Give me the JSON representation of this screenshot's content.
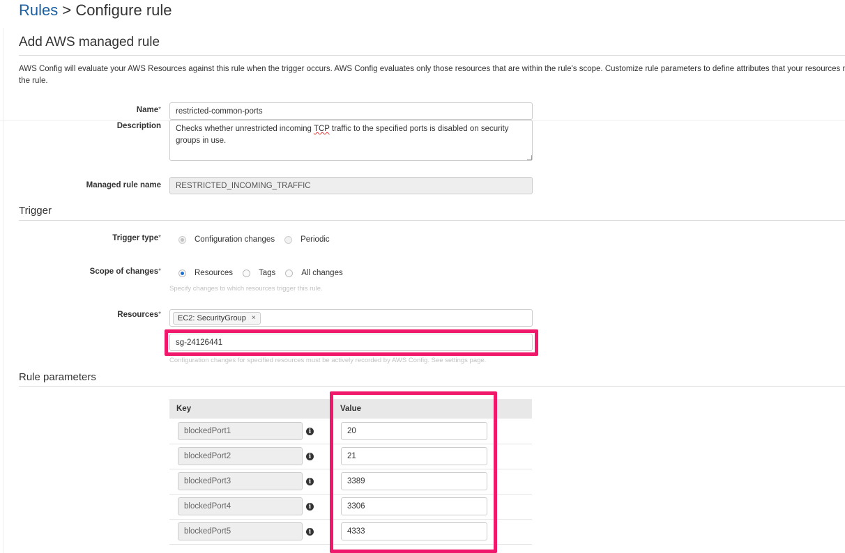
{
  "breadcrumb": {
    "link": "Rules",
    "separator": " > ",
    "current": "Configure rule"
  },
  "page_heading": "Add AWS managed rule",
  "intro_line1": "AWS Config will evaluate your AWS Resources against this rule when the trigger occurs. AWS Config evaluates only those resources that are within the rule's scope. Customize rule parameters to define attributes that your resources m",
  "intro_line2": "the rule.",
  "form": {
    "name_label": "Name",
    "required_mark": "*",
    "name_value": "restricted-common-ports",
    "description_label": "Description",
    "description_before": "Checks whether unrestricted incoming ",
    "description_spellword": "TCP",
    "description_after": " traffic to the specified ports is disabled on security groups in use.",
    "managed_rule_label": "Managed rule name",
    "managed_rule_value": "RESTRICTED_INCOMING_TRAFFIC"
  },
  "trigger": {
    "section_title": "Trigger",
    "trigger_type_label": "Trigger type",
    "trigger_options": [
      "Configuration changes",
      "Periodic"
    ],
    "trigger_selected": "Configuration changes",
    "scope_label": "Scope of changes",
    "scope_options": [
      "Resources",
      "Tags",
      "All changes"
    ],
    "scope_selected": "Resources",
    "scope_help": "Specify changes to which resources trigger this rule.",
    "resources_label": "Resources",
    "resource_token": "EC2: SecurityGroup",
    "resource_token_remove": "×",
    "resource_id_value": "sg-24126441",
    "resources_help": "Configuration changes for specified resources must be actively recorded by AWS Config. See settings page."
  },
  "rule_parameters": {
    "section_title": "Rule parameters",
    "columns": [
      "Key",
      "Value"
    ],
    "info_glyph": "i",
    "rows": [
      {
        "key": "blockedPort1",
        "value": "20"
      },
      {
        "key": "blockedPort2",
        "value": "21"
      },
      {
        "key": "blockedPort3",
        "value": "3389"
      },
      {
        "key": "blockedPort4",
        "value": "3306"
      },
      {
        "key": "blockedPort5",
        "value": "4333"
      }
    ]
  },
  "colors": {
    "link": "#1a5fa3",
    "highlight": "#f0186a",
    "radio_selected": "#1a6fd0"
  },
  "icons": {
    "remove_token": "close-icon",
    "info": "info-icon"
  }
}
